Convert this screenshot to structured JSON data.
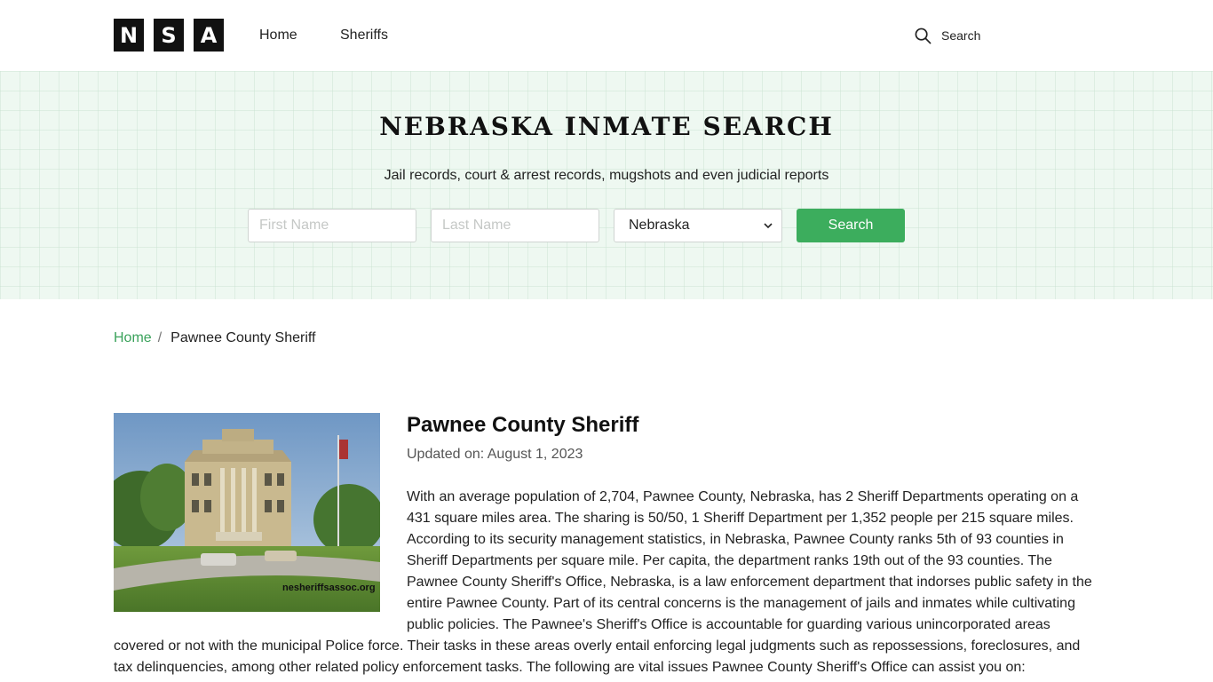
{
  "header": {
    "logo_letters": [
      "N",
      "S",
      "A"
    ],
    "nav": {
      "home": "Home",
      "sheriffs": "Sheriffs"
    },
    "search_label": "Search"
  },
  "hero": {
    "title": "NEBRASKA INMATE SEARCH",
    "subtitle": "Jail records, court & arrest records, mugshots and even judicial reports",
    "first_name_placeholder": "First Name",
    "last_name_placeholder": "Last Name",
    "state_selected": "Nebraska",
    "search_button": "Search"
  },
  "breadcrumb": {
    "home": "Home",
    "separator": "/",
    "current": "Pawnee County Sheriff"
  },
  "article": {
    "title": "Pawnee County Sheriff",
    "updated": "Updated on: August 1, 2023",
    "photo_watermark": "nesheriffsassoc.org",
    "body": "With an average population of 2,704, Pawnee County, Nebraska, has 2 Sheriff Departments operating on a 431 square miles area. The sharing is 50/50, 1 Sheriff Department per 1,352 people per 215 square miles. According to its security management statistics, in Nebraska, Pawnee County ranks 5th of 93 counties in Sheriff Departments per square mile. Per capita, the department ranks 19th out of the 93 counties. The Pawnee County Sheriff's Office, Nebraska, is a law enforcement department that indorses public safety in the entire Pawnee County. Part of its central concerns is the management of jails and inmates while cultivating public policies. The Pawnee's Sheriff's Office is accountable for guarding various unincorporated areas covered or not with the municipal Police force. Their tasks in these areas overly entail enforcing legal judgments such as repossessions, foreclosures, and tax delinquencies, among other related policy enforcement tasks. The following are vital issues Pawnee County Sheriff's Office can assist you on:"
  },
  "colors": {
    "accent_green": "#3cad5d",
    "link_green": "#3aa25b",
    "hero_background": "#eef8f1"
  }
}
